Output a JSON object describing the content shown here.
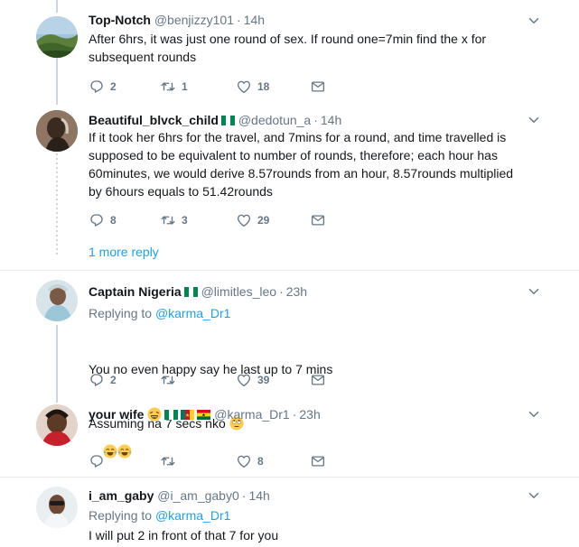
{
  "tweets": [
    {
      "name": "Top-Notch",
      "handle": "@benjizzy101",
      "time": "14h",
      "text": "After 6hrs, it was just one round of sex. If round one=7min find the x for subsequent rounds",
      "replies": "2",
      "retweets": "1",
      "likes": "18"
    },
    {
      "name": "Beautiful_blvck_child",
      "handle": "@dedotun_a",
      "time": "14h",
      "text": "If it took her 6hrs for the travel, and 7mins for a round, and time travelled is supposed to be equivalent to number of rounds, therefore; each hour has 60minutes, we would derive 8.57rounds from an hour, 8.57rounds multiplied by 6hours equals to 51.42rounds",
      "replies": "8",
      "retweets": "3",
      "likes": "29"
    },
    {
      "name": "Captain Nigeria",
      "handle": "@limitles_leo",
      "time": "23h",
      "replying_label": "Replying to",
      "replying_to": "@karma_Dr1",
      "text_line1": "You no even happy say he last up to 7 mins",
      "text_line2": "Assuming na 7 secs nko",
      "replies": "2",
      "likes": "39"
    },
    {
      "name": "your wife",
      "handle": "@karma_Dr1",
      "time": "23h",
      "likes": "8"
    },
    {
      "name": "i_am_gaby",
      "handle": "@i_am_gaby0",
      "time": "14h",
      "replying_label": "Replying to",
      "replying_to": "@karma_Dr1",
      "text": "I will put 2 in front of that 7 for you"
    }
  ],
  "more_replies": "1 more reply",
  "colors": {
    "link": "#1da1f2",
    "muted": "#657786",
    "text": "#14171a",
    "separator": "#e6ecf0",
    "thread": "#ccd6dd"
  },
  "icons": {
    "reply": "reply-icon",
    "retweet": "retweet-icon",
    "like": "heart-icon",
    "message": "envelope-icon",
    "menu": "chevron-down-icon"
  }
}
